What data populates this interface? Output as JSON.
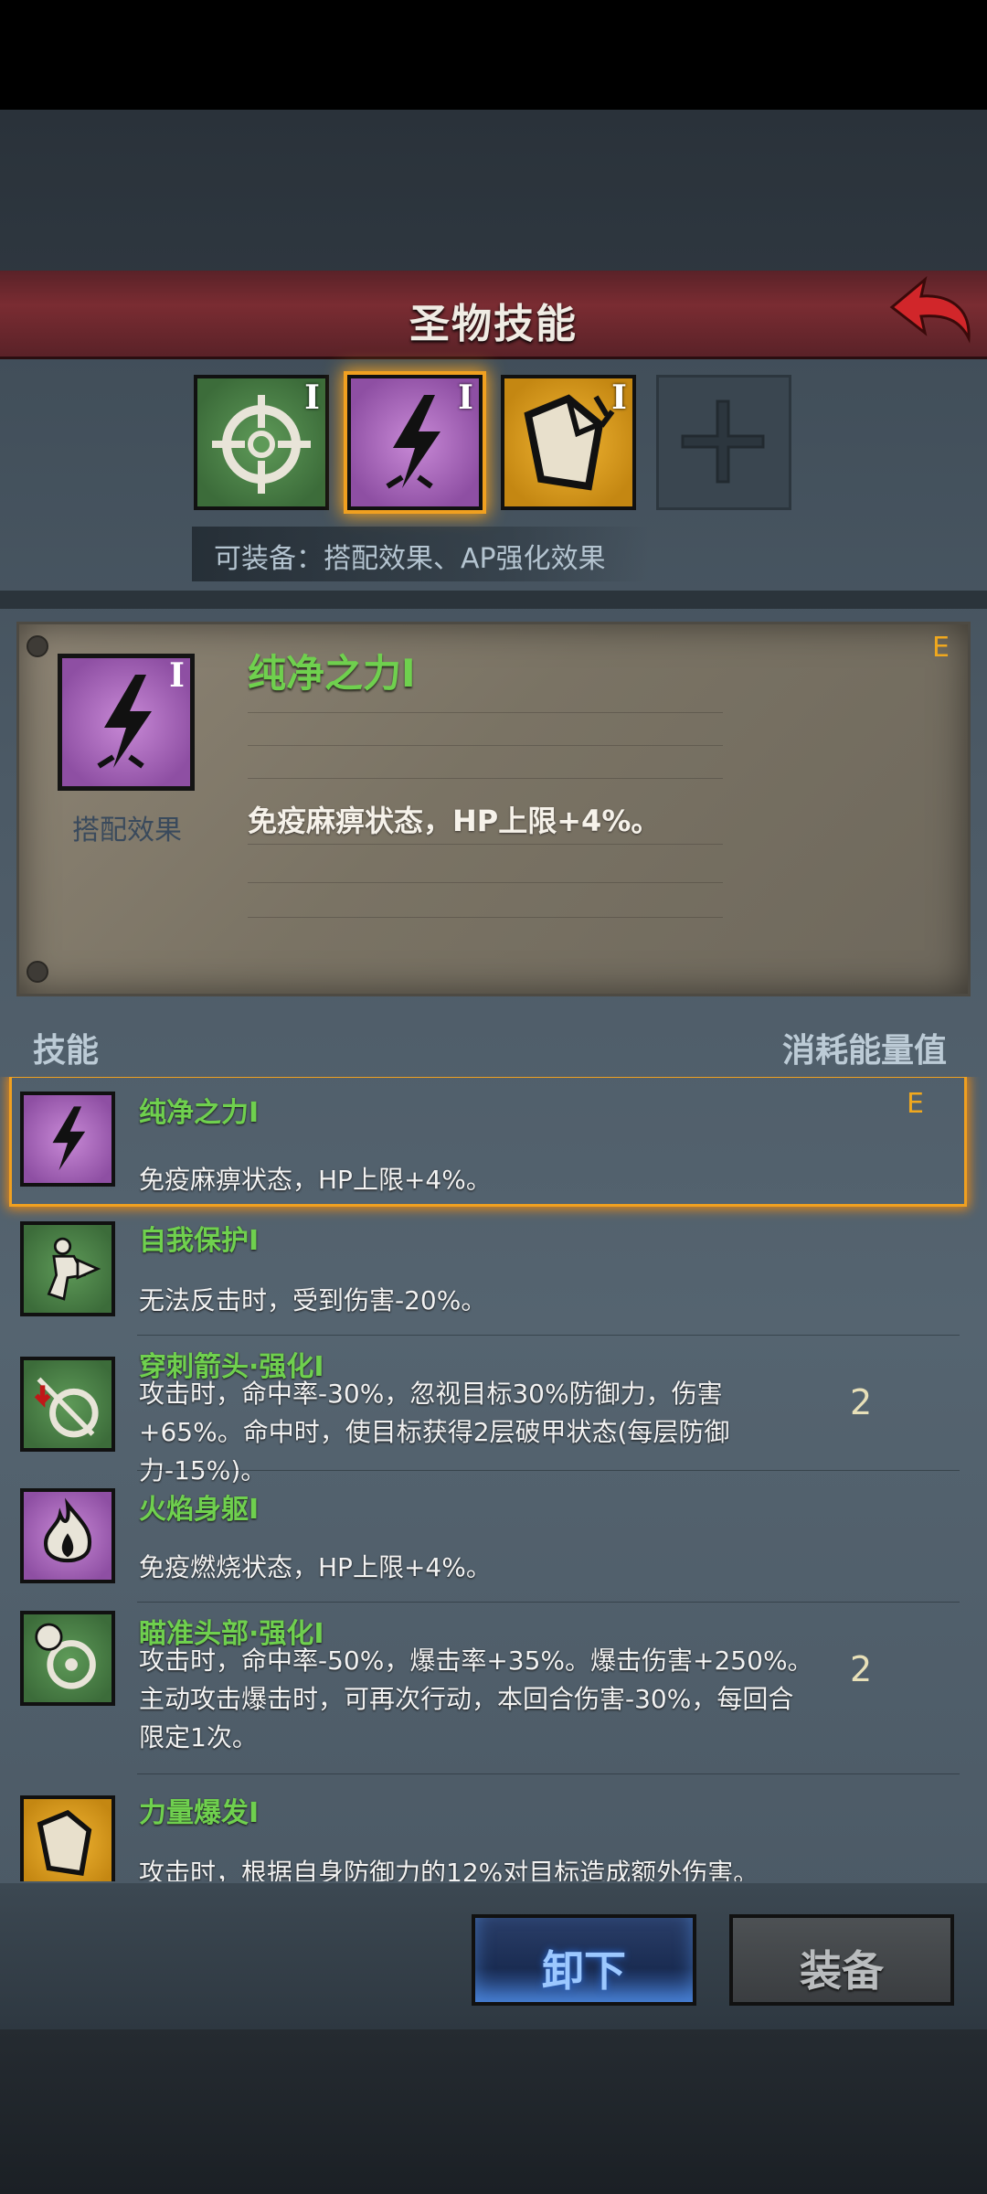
{
  "header": {
    "title": "圣物技能"
  },
  "slots": {
    "roman": "I",
    "equip_hint": "可装备：搭配效果、AP强化效果"
  },
  "detail": {
    "name": "纯净之力I",
    "grade": "E",
    "type_label": "搭配效果",
    "description": "免疫麻痹状态，HP上限+4%。",
    "roman": "I"
  },
  "list_header": {
    "left": "技能",
    "right": "消耗能量值"
  },
  "skills": [
    {
      "name": "纯净之力I",
      "desc": "免疫麻痹状态，HP上限+4%。",
      "grade": "E",
      "cost": ""
    },
    {
      "name": "自我保护I",
      "desc": "无法反击时，受到伤害-20%。",
      "cost": ""
    },
    {
      "name": "穿刺箭头·强化I",
      "desc": "攻击时，命中率-30%，忽视目标30%防御力，伤害+65%。命中时，使目标获得2层破甲状态(每层防御力-15%)。",
      "cost": "2"
    },
    {
      "name": "火焰身躯I",
      "desc": "免疫燃烧状态，HP上限+4%。",
      "cost": ""
    },
    {
      "name": "瞄准头部·强化I",
      "desc": "攻击时，命中率-50%，爆击率+35%。爆击伤害+250%。主动攻击爆击时，可再次行动，本回合伤害-30%，每回合限定1次。",
      "cost": "2"
    },
    {
      "name": "力量爆发I",
      "desc": "攻击时，根据自身防御力的12%对目标造成额外伤害。",
      "cost": ""
    }
  ],
  "buttons": {
    "unload": "卸下",
    "equip": "装备"
  }
}
